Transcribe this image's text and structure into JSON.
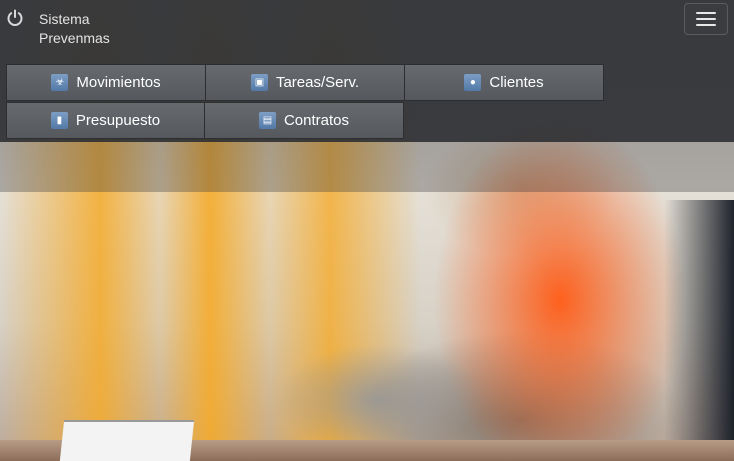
{
  "header": {
    "app_title_line1": "Sistema",
    "app_title_line2": "Prevenmas",
    "power_icon": "power-icon",
    "menu_icon": "hamburger-icon"
  },
  "nav": {
    "items": [
      {
        "label": "Movimientos",
        "icon": "movimientos-icon"
      },
      {
        "label": "Tareas/Serv.",
        "icon": "box-icon"
      },
      {
        "label": "Clientes",
        "icon": "user-icon"
      },
      {
        "label": "Presupuesto",
        "icon": "clipboard-icon"
      },
      {
        "label": "Contratos",
        "icon": "document-icon"
      }
    ]
  },
  "colors": {
    "header_bg": "#34363a",
    "button_bg": "#5f6267",
    "icon_blue": "#5279a8",
    "text": "#ffffff"
  }
}
